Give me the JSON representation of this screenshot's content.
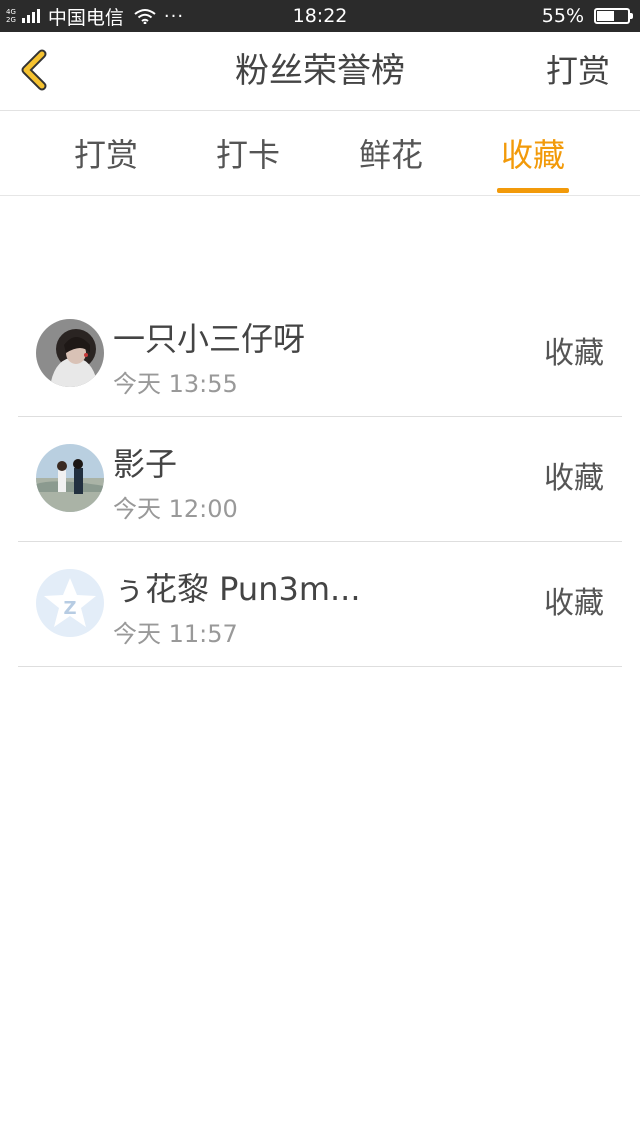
{
  "status_bar": {
    "net_top": "4G",
    "net_bottom": "2G",
    "carrier": "中国电信",
    "dots": "···",
    "time": "18:22",
    "battery_text": "55%",
    "battery_level": 0.55
  },
  "header": {
    "title": "粉丝荣誉榜",
    "right_label": "打赏",
    "back_icon": "chevron-left-icon",
    "accent_color": "#f29a0a"
  },
  "tabs": [
    {
      "label": "打赏",
      "active": false
    },
    {
      "label": "打卡",
      "active": false
    },
    {
      "label": "鲜花",
      "active": false
    },
    {
      "label": "收藏",
      "active": true
    }
  ],
  "list": [
    {
      "name": "一只小三仔呀",
      "time": "今天 13:55",
      "action": "收藏"
    },
    {
      "name": "影子",
      "time": "今天 12:00",
      "action": "收藏"
    },
    {
      "name": "ぅ花黎 Pun3m...",
      "time": "今天 11:57",
      "action": "收藏"
    }
  ]
}
